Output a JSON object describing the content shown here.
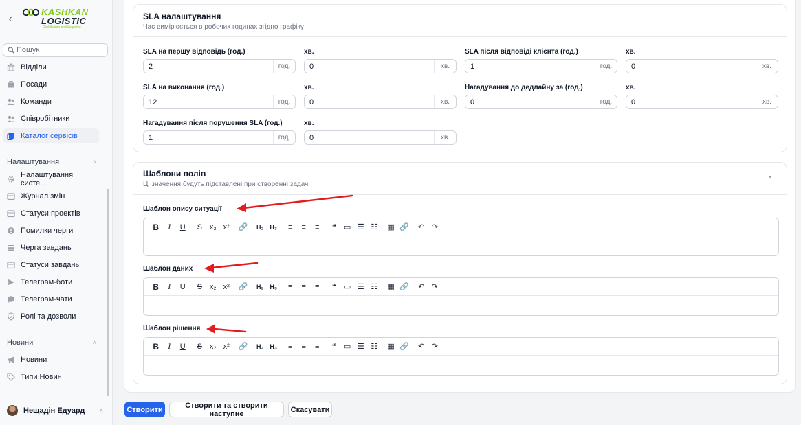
{
  "sidebar": {
    "logo": {
      "line1": "KASHKAN",
      "line2": "LOGISTIC",
      "line3": "Distribution and Logistics"
    },
    "search_placeholder": "Пошук",
    "items_top": [
      {
        "label": "Відділи",
        "icon": "building-icon"
      },
      {
        "label": "Посади",
        "icon": "briefcase-icon"
      },
      {
        "label": "Команди",
        "icon": "users-icon"
      },
      {
        "label": "Співробітники",
        "icon": "user-group-icon"
      },
      {
        "label": "Каталог сервісів",
        "icon": "catalog-icon",
        "active": true
      }
    ],
    "group_settings": "Налаштування",
    "items_settings": [
      {
        "label": "Налаштування систе...",
        "icon": "gear-icon"
      },
      {
        "label": "Журнал змін",
        "icon": "archive-icon"
      },
      {
        "label": "Статуси проектів",
        "icon": "folder-icon"
      },
      {
        "label": "Помилки черги",
        "icon": "alert-icon"
      },
      {
        "label": "Черга завдань",
        "icon": "queue-icon"
      },
      {
        "label": "Статуси завдань",
        "icon": "folder-icon"
      },
      {
        "label": "Телеграм-боти",
        "icon": "send-icon"
      },
      {
        "label": "Телеграм-чати",
        "icon": "chat-icon"
      },
      {
        "label": "Ролі та дозволи",
        "icon": "shield-icon"
      }
    ],
    "group_news": "Новини",
    "items_news": [
      {
        "label": "Новини",
        "icon": "megaphone-icon"
      },
      {
        "label": "Типи Новин",
        "icon": "tag-icon"
      }
    ],
    "user_name": "Нещадін Едуард"
  },
  "sla": {
    "title": "SLA налаштування",
    "subtitle": "Час вимірюється в робочих годинах згідно графіку",
    "fields": [
      {
        "label": "SLA на першу відповідь (год.)",
        "value": "2",
        "suffix": "год."
      },
      {
        "label": "хв.",
        "value": "0",
        "suffix": "хв."
      },
      {
        "label": "SLA після відповіді клієнта (год.)",
        "value": "1",
        "suffix": "год."
      },
      {
        "label": "хв.",
        "value": "0",
        "suffix": "хв."
      },
      {
        "label": "SLA на виконання (год.)",
        "value": "12",
        "suffix": "год."
      },
      {
        "label": "хв.",
        "value": "0",
        "suffix": "хв."
      },
      {
        "label": "Нагадування до дедлайну за (год.)",
        "value": "0",
        "suffix": "год."
      },
      {
        "label": "хв.",
        "value": "0",
        "suffix": "хв."
      },
      {
        "label": "Нагадування після порушення SLA (год.)",
        "value": "1",
        "suffix": "год."
      },
      {
        "label": "хв.",
        "value": "0",
        "suffix": "хв."
      }
    ]
  },
  "templates": {
    "title": "Шаблони полів",
    "subtitle": "Ці значення будуть підставлені при створенні задачі",
    "editors": [
      {
        "label": "Шаблон опису ситуації"
      },
      {
        "label": "Шаблон даних"
      },
      {
        "label": "Шаблон рішення"
      }
    ],
    "toolbar": [
      "B",
      "I",
      "U",
      "S",
      "x₂",
      "x²",
      "🔗",
      "H₂",
      "H₃",
      "≡",
      "≡",
      "≡",
      "❝",
      "▭",
      "☰",
      "☷",
      "▦",
      "🔗",
      "↶",
      "↷"
    ]
  },
  "actions": {
    "create": "Створити",
    "create_next": "Створити та створити наступне",
    "cancel": "Скасувати"
  },
  "colors": {
    "primary": "#2563eb",
    "annotation_arrow": "#e11d1d",
    "logo_green": "#84cc16"
  }
}
